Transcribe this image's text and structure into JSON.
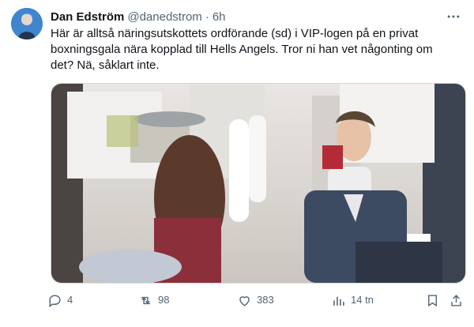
{
  "tweet": {
    "author_name": "Dan Edström",
    "author_handle": "@danedstrom",
    "separator": "·",
    "time": "6h",
    "text": "Här är alltså näringsutskottets ordförande (sd) i VIP-logen på en privat boxningsgala nära kopplad till Hells Angels. Tror ni han vet någonting om det? Nä, såklart inte."
  },
  "actions": {
    "reply_count": "4",
    "retweet_count": "98",
    "like_count": "383",
    "views_count": "14 tn"
  },
  "icons": {
    "more": "more-dots-icon",
    "reply": "reply-icon",
    "retweet": "retweet-icon",
    "like": "heart-icon",
    "views": "views-chart-icon",
    "bookmark": "bookmark-icon",
    "share": "share-icon"
  },
  "colors": {
    "text": "#0f1419",
    "secondary": "#536471",
    "border": "#cfd9de"
  }
}
